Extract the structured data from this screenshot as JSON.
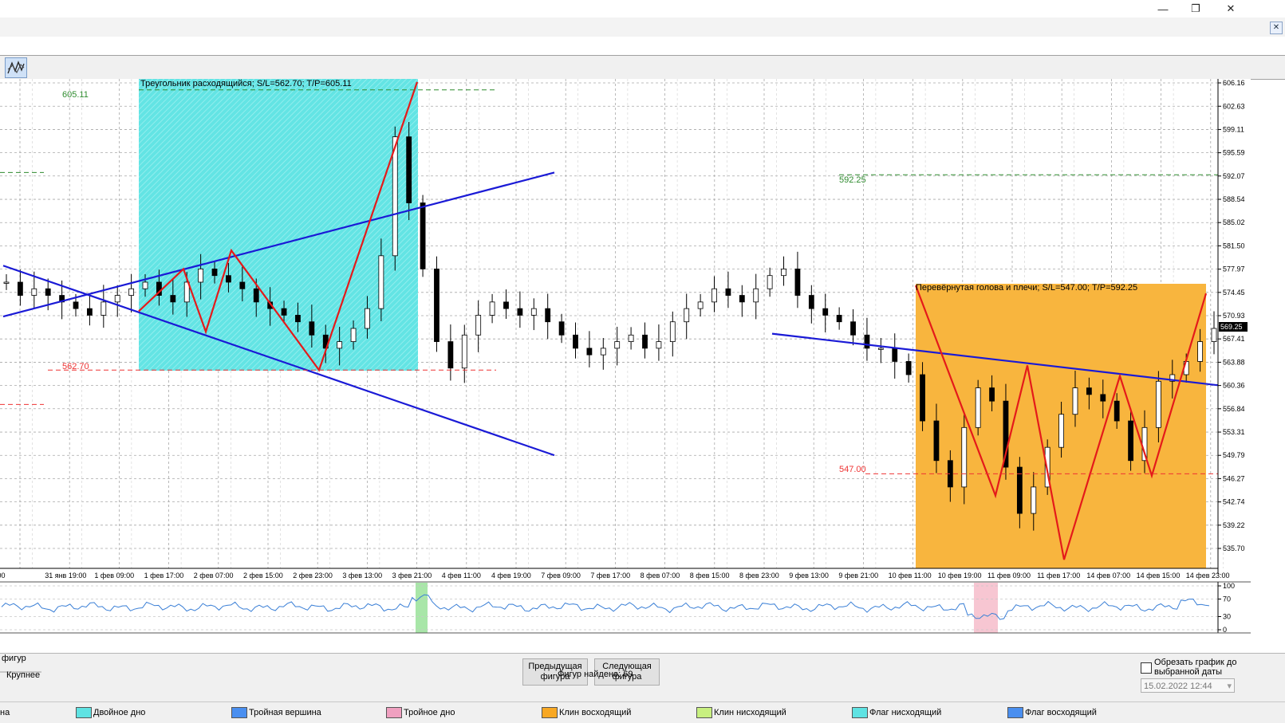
{
  "window": {
    "minimize_glyph": "—",
    "restore_glyph": "❐",
    "close_glyph": "✕"
  },
  "chart_close_glyph": "✕",
  "toolbar": {
    "pattern_tool_icon": "zigzag-lines-icon"
  },
  "price_axis": {
    "ticks": [
      "606.16",
      "602.63",
      "599.11",
      "595.59",
      "592.07",
      "588.54",
      "585.02",
      "581.50",
      "577.97",
      "574.45",
      "570.93",
      "567.41",
      "563.88",
      "560.36",
      "556.84",
      "553.31",
      "549.79",
      "546.27",
      "542.74",
      "539.22",
      "535.70"
    ],
    "current_price": "569.25"
  },
  "time_axis": {
    "ticks": [
      ":00",
      "31 янв 19:00",
      "1 фев 09:00",
      "1 фев 17:00",
      "2 фев 07:00",
      "2 фев 15:00",
      "2 фев 23:00",
      "3 фев 13:00",
      "3 фев 21:00",
      "4 фев 11:00",
      "4 фев 19:00",
      "7 фев 09:00",
      "7 фев 17:00",
      "8 фев 07:00",
      "8 фев 15:00",
      "8 фев 23:00",
      "9 фев 13:00",
      "9 фев 21:00",
      "10 фев 11:00",
      "10 фев 19:00",
      "11 фев 09:00",
      "11 фев 17:00",
      "14 фев 07:00",
      "14 фев 15:00",
      "14 фев 23:00"
    ]
  },
  "pattern1": {
    "label": "Треугольник расходящийся; S/L=562.70; T/P=605.11",
    "tp_label": "605.11",
    "sl_label": "562.70",
    "color": "#5fe3e3"
  },
  "pattern2": {
    "label": "Перевёрнутая голова и плечи; S/L=547.00; T/P=592.25",
    "tp_label": "592.25",
    "sl_label": "547.00",
    "color": "#f8a824"
  },
  "oscillator": {
    "ticks": [
      "100",
      "70",
      "30",
      "0"
    ]
  },
  "controls": {
    "left_label_top": "фигур",
    "left_label_bottom": "Крупнее",
    "prev_button": "Предыдущая фигура",
    "next_button": "Следующая фигура",
    "found_text": "Фигур найдено: 69",
    "crop_checkbox": "Обрезать график до выбранной даты",
    "date_value": "15.02.2022 12:44"
  },
  "legend": [
    {
      "label": "на",
      "color": "#ffffff"
    },
    {
      "label": "Двойное дно",
      "color": "#5fe3e3"
    },
    {
      "label": "Тройная вершина",
      "color": "#4a8ff0"
    },
    {
      "label": "Тройное дно",
      "color": "#f0a0c0"
    },
    {
      "label": "Клин восходящий",
      "color": "#f8a824"
    },
    {
      "label": "Клин нисходящий",
      "color": "#c8f080"
    },
    {
      "label": "Флаг нисходящий",
      "color": "#5fe3e3"
    },
    {
      "label": "Флаг восходящий",
      "color": "#4a8ff0"
    }
  ],
  "chart_data": {
    "type": "candlestick",
    "y_range": [
      533,
      607
    ],
    "x_tick_labels": [
      "31 янв 19:00",
      "1 фев 09:00",
      "1 фев 17:00",
      "2 фев 07:00",
      "2 фев 15:00",
      "2 фев 23:00",
      "3 фев 13:00",
      "3 фев 21:00",
      "4 фев 11:00",
      "4 фев 19:00",
      "7 фев 09:00",
      "7 фев 17:00",
      "8 фев 07:00",
      "8 фев 15:00",
      "8 фев 23:00",
      "9 фев 13:00",
      "9 фев 21:00",
      "10 фев 11:00",
      "10 фев 19:00",
      "11 фев 09:00",
      "11 фев 17:00",
      "14 фев 07:00",
      "14 фев 15:00",
      "14 фев 23:00"
    ],
    "approx_close_path": [
      576,
      574,
      575,
      574,
      573,
      572,
      571,
      573,
      574,
      575,
      576,
      574,
      573,
      576,
      578,
      577,
      576,
      575,
      573,
      572,
      571,
      570,
      568,
      566,
      567,
      569,
      572,
      580,
      598,
      588,
      578,
      567,
      563,
      568,
      571,
      573,
      572,
      571,
      572,
      570,
      568,
      566,
      565,
      566,
      567,
      568,
      566,
      567,
      570,
      572,
      573,
      575,
      574,
      573,
      575,
      577,
      578,
      574,
      572,
      571,
      570,
      568,
      566,
      566,
      564,
      562,
      555,
      549,
      545,
      554,
      560,
      558,
      548,
      541,
      545,
      551,
      556,
      560,
      559,
      558,
      555,
      549,
      554,
      561,
      562,
      564,
      567,
      569
    ],
    "current_price": 569.25,
    "grid": true
  }
}
